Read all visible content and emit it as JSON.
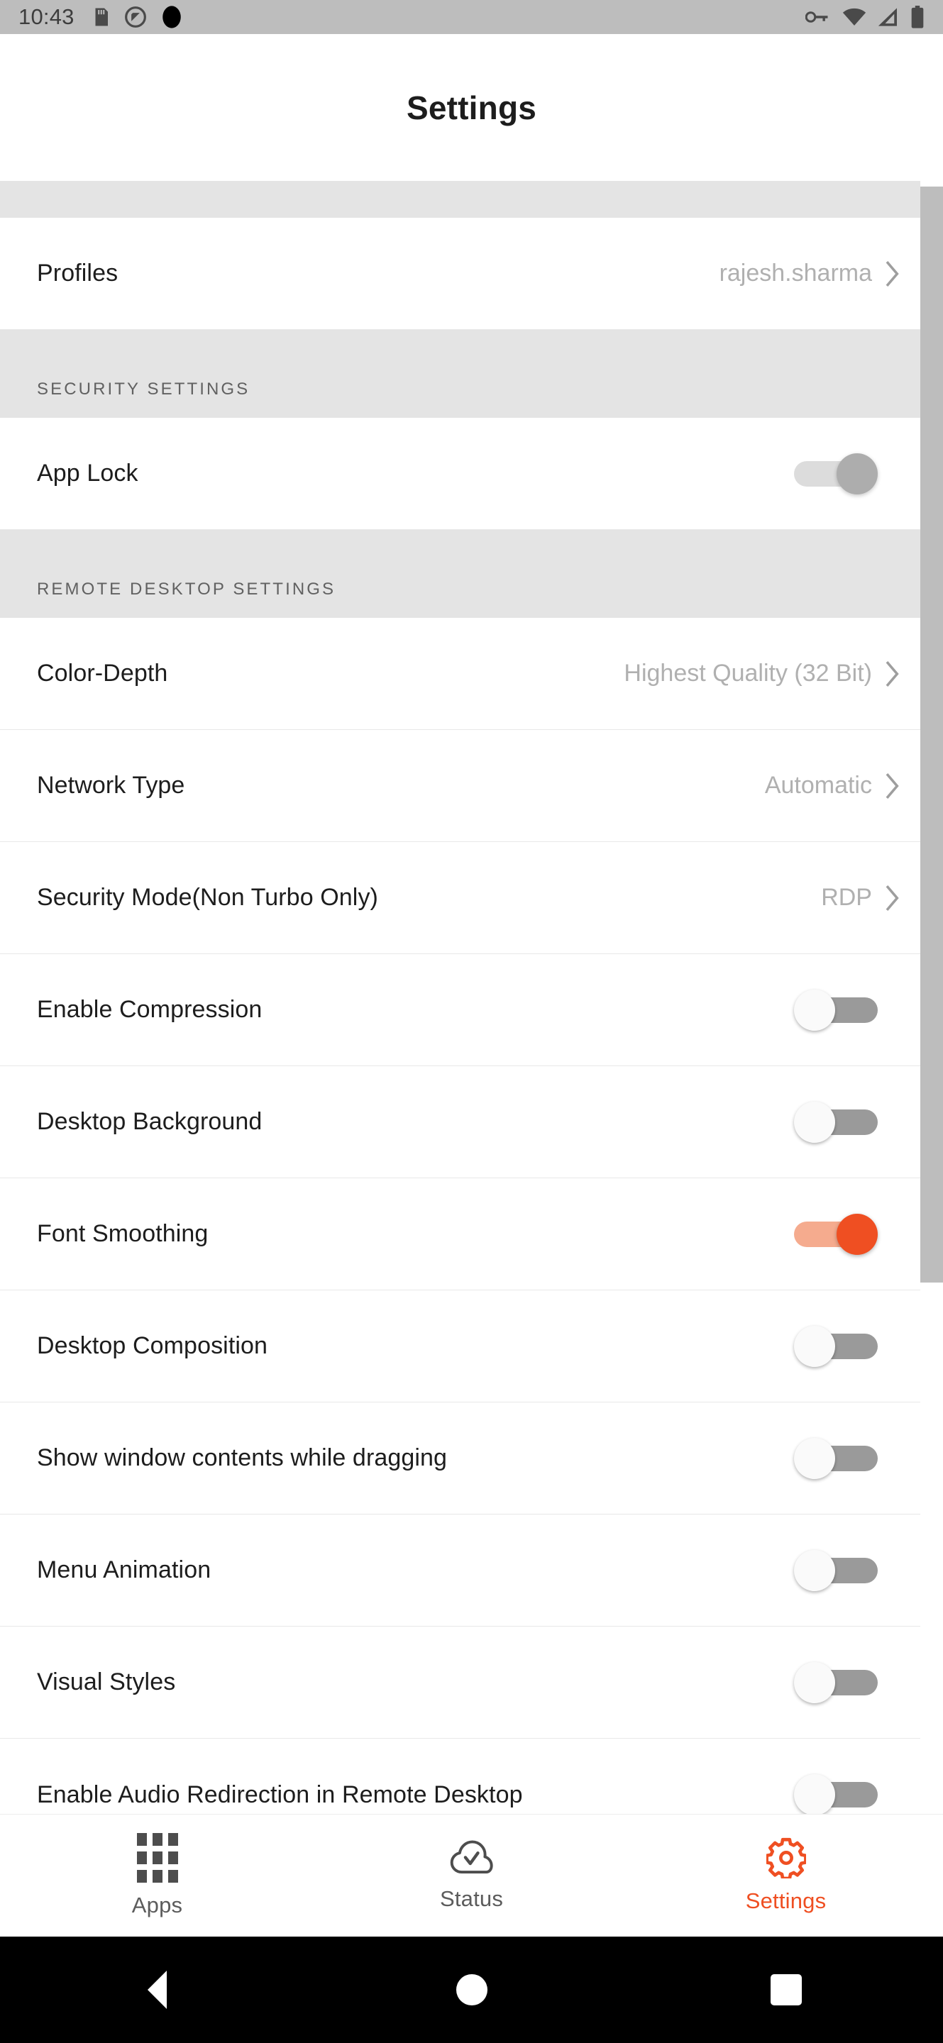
{
  "statusbar": {
    "time": "10:43",
    "left_icons": [
      "sd-card-icon",
      "do-not-disturb-icon",
      "camera-cutout-icon"
    ],
    "right_icons": [
      "vpn-key-icon",
      "wifi-icon",
      "cellular-signal-icon",
      "battery-icon"
    ]
  },
  "appbar": {
    "title": "Settings"
  },
  "colors": {
    "accent": "#ef4f22",
    "accent_track": "#f5ab8e",
    "section_header_bg": "#e4e4e4",
    "statusbar_bg": "#bdbdbd",
    "value_text": "#b0b0b0",
    "label_text": "#1d1d1d"
  },
  "sections": [
    {
      "header": "",
      "rows": [
        {
          "label": "Profiles",
          "value": "rajesh.sharma",
          "type": "navigation"
        }
      ]
    },
    {
      "header": "SECURITY SETTINGS",
      "rows": [
        {
          "label": "App Lock",
          "type": "toggle",
          "state": "on-disabled"
        }
      ]
    },
    {
      "header": "REMOTE DESKTOP SETTINGS",
      "rows": [
        {
          "label": "Color-Depth",
          "value": "Highest Quality (32 Bit)",
          "type": "navigation"
        },
        {
          "label": "Network Type",
          "value": "Automatic",
          "type": "navigation"
        },
        {
          "label": "Security Mode(Non Turbo Only)",
          "value": "RDP",
          "type": "navigation"
        },
        {
          "label": "Enable Compression",
          "type": "toggle",
          "state": "off"
        },
        {
          "label": "Desktop Background",
          "type": "toggle",
          "state": "off"
        },
        {
          "label": "Font Smoothing",
          "type": "toggle",
          "state": "on"
        },
        {
          "label": "Desktop Composition",
          "type": "toggle",
          "state": "off"
        },
        {
          "label": "Show window contents while dragging",
          "type": "toggle",
          "state": "off"
        },
        {
          "label": "Menu Animation",
          "type": "toggle",
          "state": "off"
        },
        {
          "label": "Visual Styles",
          "type": "toggle",
          "state": "off"
        },
        {
          "label": "Enable Audio Redirection in Remote Desktop",
          "type": "toggle",
          "state": "off",
          "clipped": true
        }
      ]
    }
  ],
  "bottomnav": {
    "items": [
      {
        "label": "Apps",
        "icon": "apps-grid-icon",
        "active": false
      },
      {
        "label": "Status",
        "icon": "cloud-check-icon",
        "active": false
      },
      {
        "label": "Settings",
        "icon": "gear-icon",
        "active": true
      }
    ]
  },
  "androidnav": {
    "back": "back-triangle-icon",
    "home": "home-circle-icon",
    "recents": "recents-square-icon"
  }
}
